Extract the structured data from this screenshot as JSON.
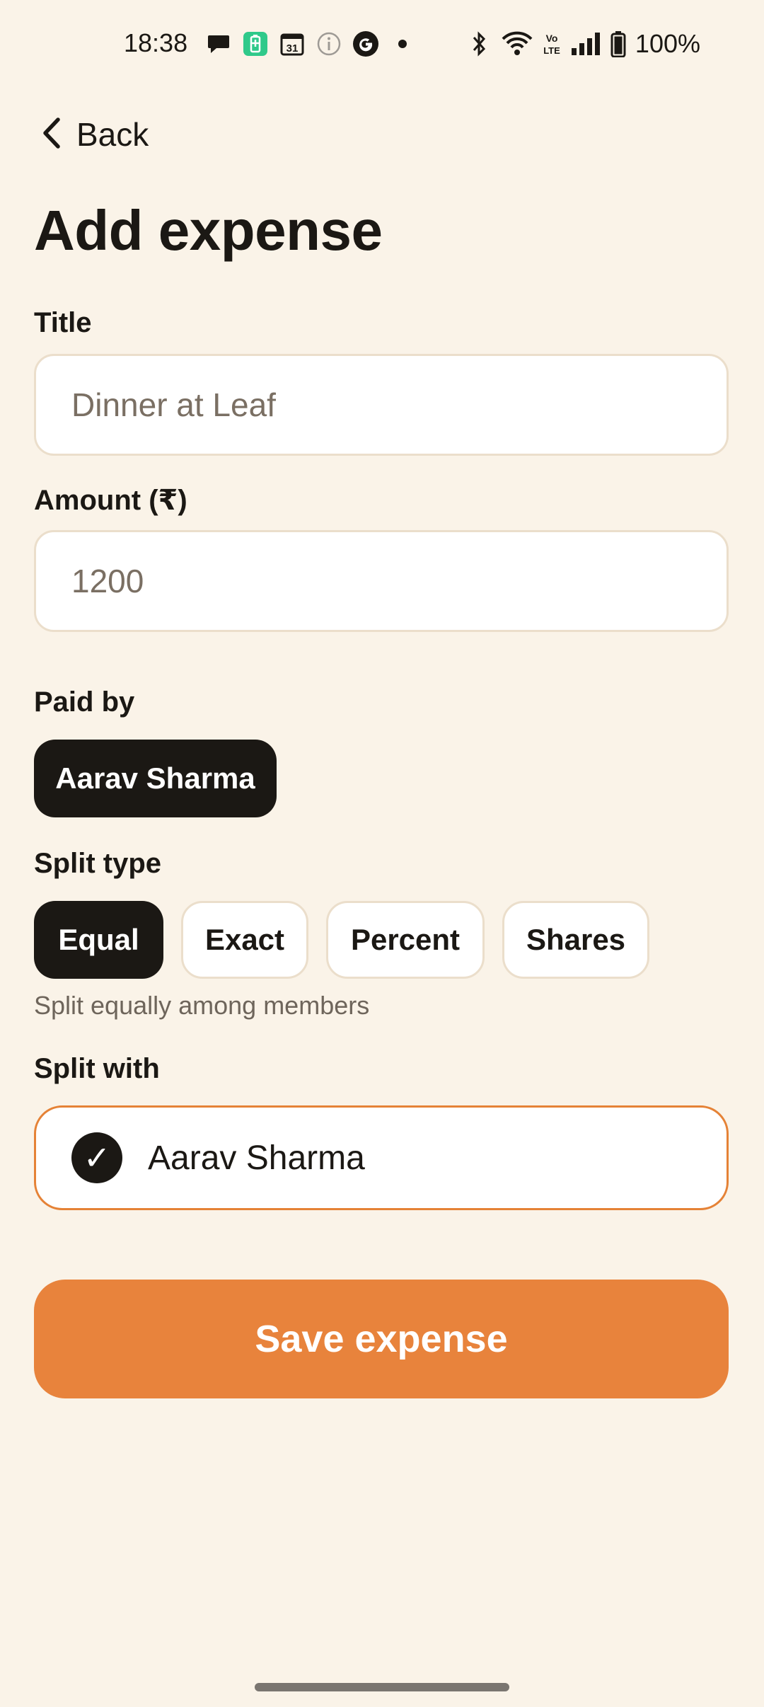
{
  "status_bar": {
    "time": "18:38",
    "battery_text": "100%",
    "icons_left": [
      "chat-bubble-icon",
      "battery-saver-icon",
      "calendar-icon",
      "info-icon",
      "google-icon",
      "dot-icon"
    ],
    "calendar_day": "31",
    "icons_right": [
      "bluetooth-icon",
      "wifi-icon",
      "volte-icon",
      "signal-icon",
      "battery-icon"
    ],
    "volte_text": "Vo LTE"
  },
  "nav": {
    "back_label": "Back"
  },
  "page": {
    "title": "Add expense"
  },
  "form": {
    "title_label": "Title",
    "title_placeholder": "Dinner at Leaf",
    "amount_label": "Amount (₹)",
    "amount_placeholder": "1200",
    "paid_by_label": "Paid by",
    "paid_by_selected": "Aarav Sharma",
    "split_type_label": "Split type",
    "split_types": [
      "Equal",
      "Exact",
      "Percent",
      "Shares"
    ],
    "split_type_selected": "Equal",
    "split_hint": "Split equally among members",
    "split_with_label": "Split with",
    "split_with_members": [
      {
        "name": "Aarav Sharma",
        "checked": true
      }
    ],
    "check_mark": "✓",
    "save_label": "Save expense"
  },
  "colors": {
    "background": "#FAF3E8",
    "accent": "#E8833C",
    "dark": "#1B1814",
    "border": "#EBDECB",
    "selected_border": "#E58236"
  }
}
